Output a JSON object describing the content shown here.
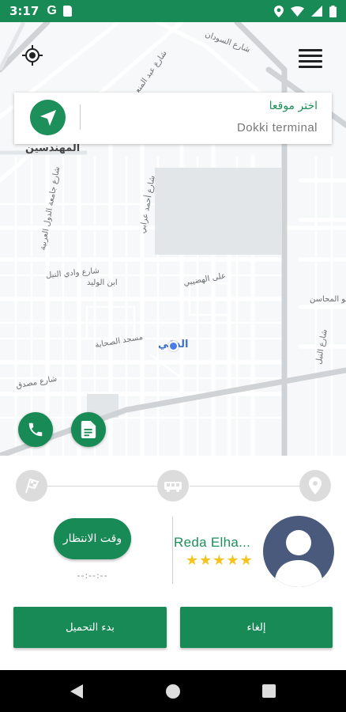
{
  "status_bar": {
    "time": "3:17",
    "g_letter": "G",
    "icons": [
      "location-icon",
      "wifi-icon",
      "signal-icon",
      "battery-icon"
    ]
  },
  "colors": {
    "primary": "#178a55",
    "star": "#f6c21c",
    "map_bg": "#eef0f1"
  },
  "map": {
    "labels": [
      {
        "text": "المهندسين",
        "style": "big"
      },
      {
        "text": "شارع عبد المنعم"
      },
      {
        "text": "شارع السودان"
      },
      {
        "text": "شارع أحمد عرابي"
      },
      {
        "text": "شارع جامعة الدول العربية"
      },
      {
        "text": "شارع وادي النيل"
      },
      {
        "text": "ابن الوليد"
      },
      {
        "text": "على الهضيبي"
      },
      {
        "text": "مسجد الصحابة"
      },
      {
        "text": "شارع مصدق"
      },
      {
        "text": "أبو المحاسن"
      },
      {
        "text": "شارع النيل"
      },
      {
        "text": "الدقي",
        "style": "blue"
      }
    ]
  },
  "search": {
    "title": "اختر موقعا",
    "location": "Dokki terminal"
  },
  "fab": {
    "call_icon": "phone-icon",
    "doc_icon": "document-icon"
  },
  "trip_steps": [
    "finish-flag-icon",
    "car-icon",
    "pin-icon"
  ],
  "wait": {
    "button_label": "وقت الانتظار",
    "time": "--:--:--"
  },
  "driver": {
    "name": "Reda Elha...",
    "rating": 5,
    "stars": "★★★★★"
  },
  "actions": {
    "start_loading": "بدء التحميل",
    "cancel": "إلغاء"
  },
  "system_nav": [
    "back-icon",
    "home-icon",
    "recents-icon"
  ]
}
